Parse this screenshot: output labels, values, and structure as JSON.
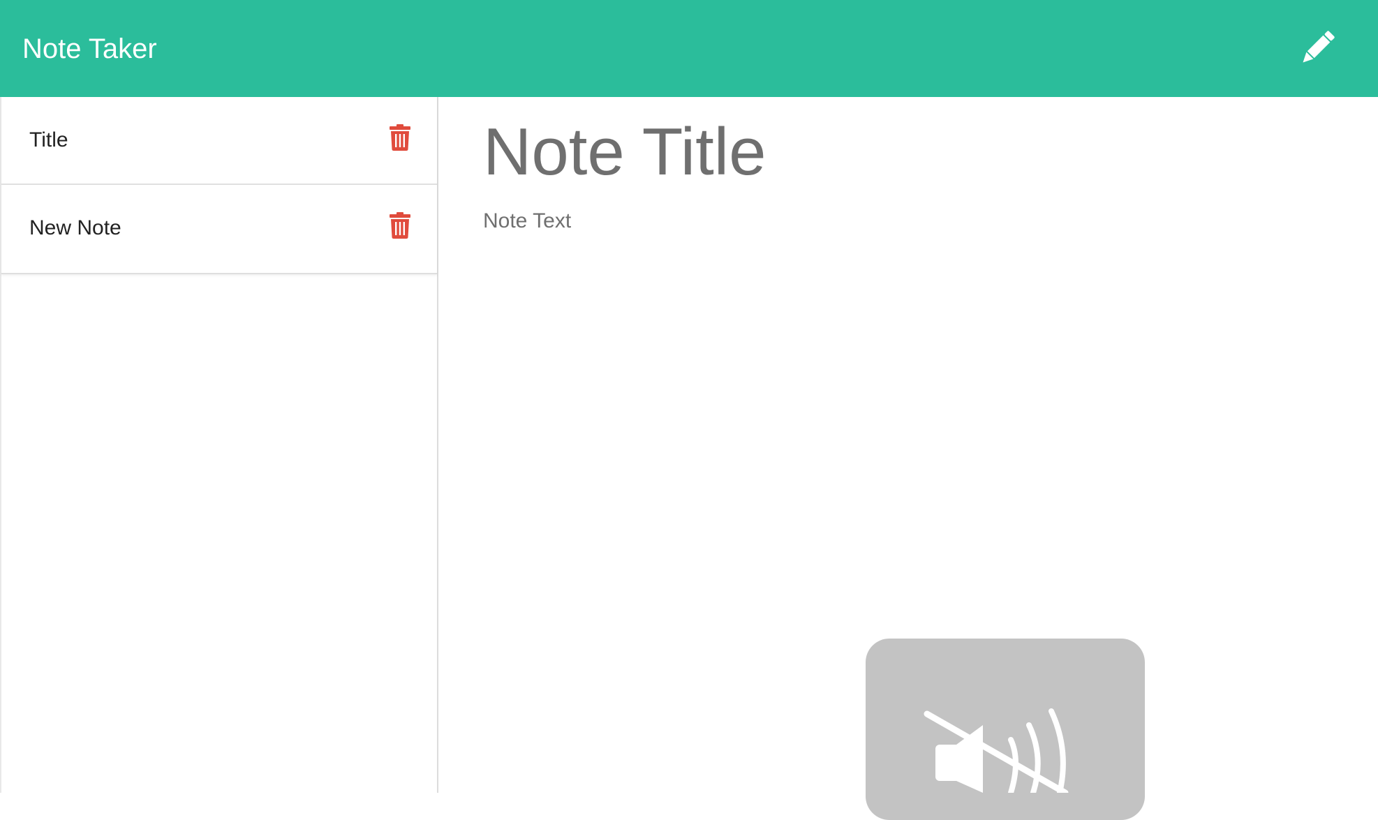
{
  "app": {
    "title": "Note Taker",
    "accent_color": "#2bbd9b",
    "new_note_icon": "pencil-icon"
  },
  "sidebar": {
    "notes": [
      {
        "title": "Title",
        "delete_icon": "trash-icon"
      },
      {
        "title": "New Note",
        "delete_icon": "trash-icon"
      }
    ],
    "delete_color": "#e04b3c"
  },
  "editor": {
    "title_placeholder": "Note Title",
    "text_placeholder": "Note Text"
  },
  "overlay": {
    "icon": "speaker-muted-icon"
  }
}
